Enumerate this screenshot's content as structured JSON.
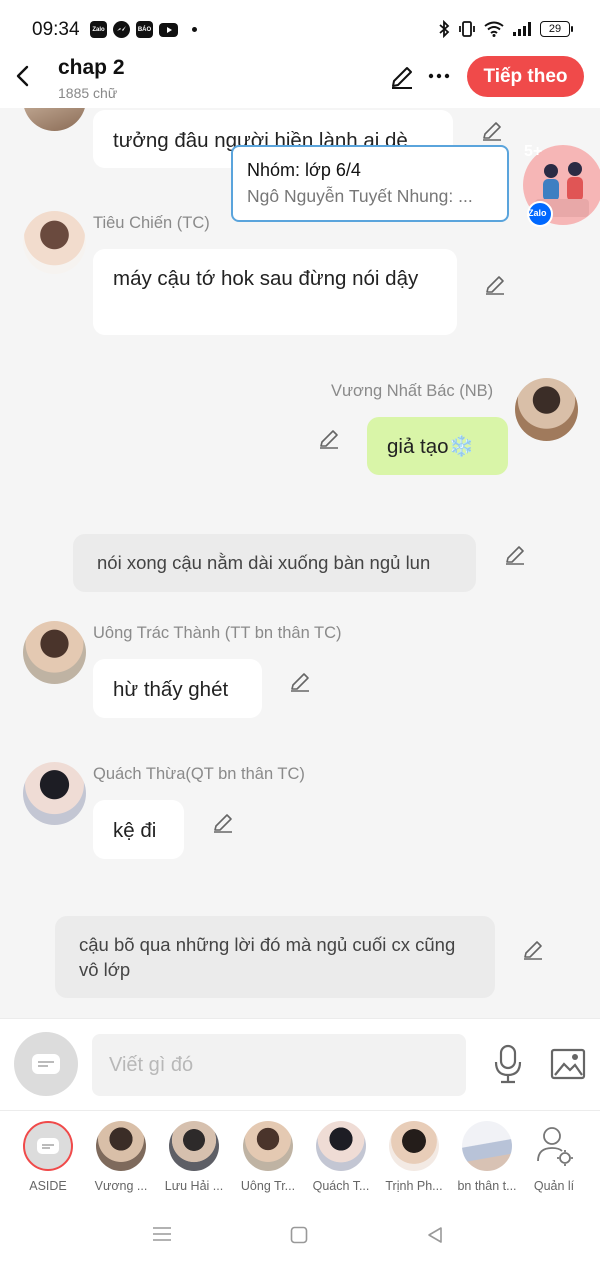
{
  "status_bar": {
    "time": "09:34",
    "apps": [
      "Zalo",
      "Messenger",
      "Báo Mới",
      "YouTube"
    ],
    "battery": "29"
  },
  "header": {
    "title": "chap 2",
    "subtitle": "1885 chữ",
    "next_button": "Tiếp theo"
  },
  "notification": {
    "title": "Nhóm: lớp 6/4",
    "body": "Ngô Nguyễn Tuyết Nhung: ...",
    "badge": "5+",
    "app_label": "Zalo"
  },
  "messages": [
    {
      "type": "bubble",
      "text": "tưởng đâu người hiền lành ai dè"
    },
    {
      "type": "bubble",
      "sender": "Tiêu Chiến (TC)",
      "text": "máy cậu tớ hok sau đừng nói dậy"
    },
    {
      "type": "bubble_mine",
      "sender": "Vương Nhất Bác (NB)",
      "text": "giả tạo❄️"
    },
    {
      "type": "narration",
      "text": "nói xong cậu nằm dài xuống bàn ngủ lun"
    },
    {
      "type": "bubble",
      "sender": "Uông Trác Thành (TT bn thân TC)",
      "text": "hừ thấy ghét"
    },
    {
      "type": "bubble",
      "sender": "Quách Thừa(QT bn thân TC)",
      "text": "kệ đi"
    },
    {
      "type": "narration",
      "text": "cậu bõ qua những lời đó mà ngủ cuối cx cũng vô lớp"
    }
  ],
  "input": {
    "placeholder": "Viết gì đó"
  },
  "characters": [
    {
      "label": "ASIDE"
    },
    {
      "label": "Vương ..."
    },
    {
      "label": "Lưu Hải ..."
    },
    {
      "label": "Uông Tr..."
    },
    {
      "label": "Quách T..."
    },
    {
      "label": "Trịnh Ph..."
    },
    {
      "label": "bn thân t..."
    },
    {
      "label": "Quản lí"
    }
  ],
  "colors": {
    "accent": "#f04a4a",
    "my_bubble": "#d9f5a8",
    "chat_bg": "#f5f5f5"
  }
}
